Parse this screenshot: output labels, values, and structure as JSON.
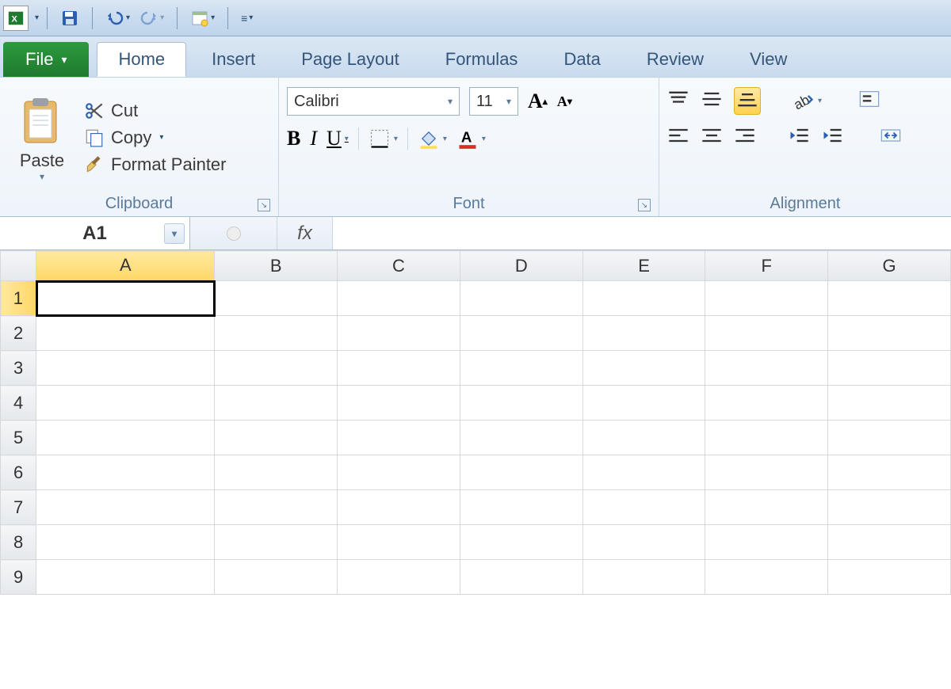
{
  "qat": {
    "save": "save-icon",
    "undo": "undo-icon",
    "redo": "redo-icon",
    "custom": "customize-icon"
  },
  "tabs": {
    "file": "File",
    "items": [
      "Home",
      "Insert",
      "Page Layout",
      "Formulas",
      "Data",
      "Review",
      "View"
    ],
    "active": "Home"
  },
  "ribbon": {
    "clipboard": {
      "paste": "Paste",
      "cut": "Cut",
      "copy": "Copy",
      "format_painter": "Format Painter",
      "label": "Clipboard"
    },
    "font": {
      "name": "Calibri",
      "size": "11",
      "label": "Font"
    },
    "alignment": {
      "label": "Alignment"
    }
  },
  "namebox": "A1",
  "fx": "fx",
  "formula": "",
  "columns": [
    "A",
    "B",
    "C",
    "D",
    "E",
    "F",
    "G"
  ],
  "rows": [
    "1",
    "2",
    "3",
    "4",
    "5",
    "6",
    "7",
    "8",
    "9"
  ],
  "selected_cell": "A1"
}
